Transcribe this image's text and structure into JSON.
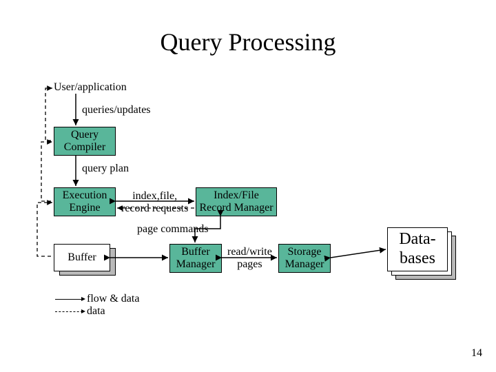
{
  "title": "Query Processing",
  "labels": {
    "user_app": "User/application",
    "queries_updates": "queries/updates",
    "query_compiler": "Query\nCompiler",
    "query_plan": "query plan",
    "execution_engine": "Execution\nEngine",
    "index_file": "index,file,\nrecord requests",
    "record_manager": "Index/File\nRecord Manager",
    "page_commands": "page commands",
    "buffer": "Buffer",
    "buffer_manager": "Buffer\nManager",
    "read_write_pages": "read/write\npages",
    "storage_manager": "Storage\nManager",
    "databases": "Data-\nbases",
    "legend_flow": "flow & data",
    "legend_data": "data"
  },
  "slide_number": "14"
}
